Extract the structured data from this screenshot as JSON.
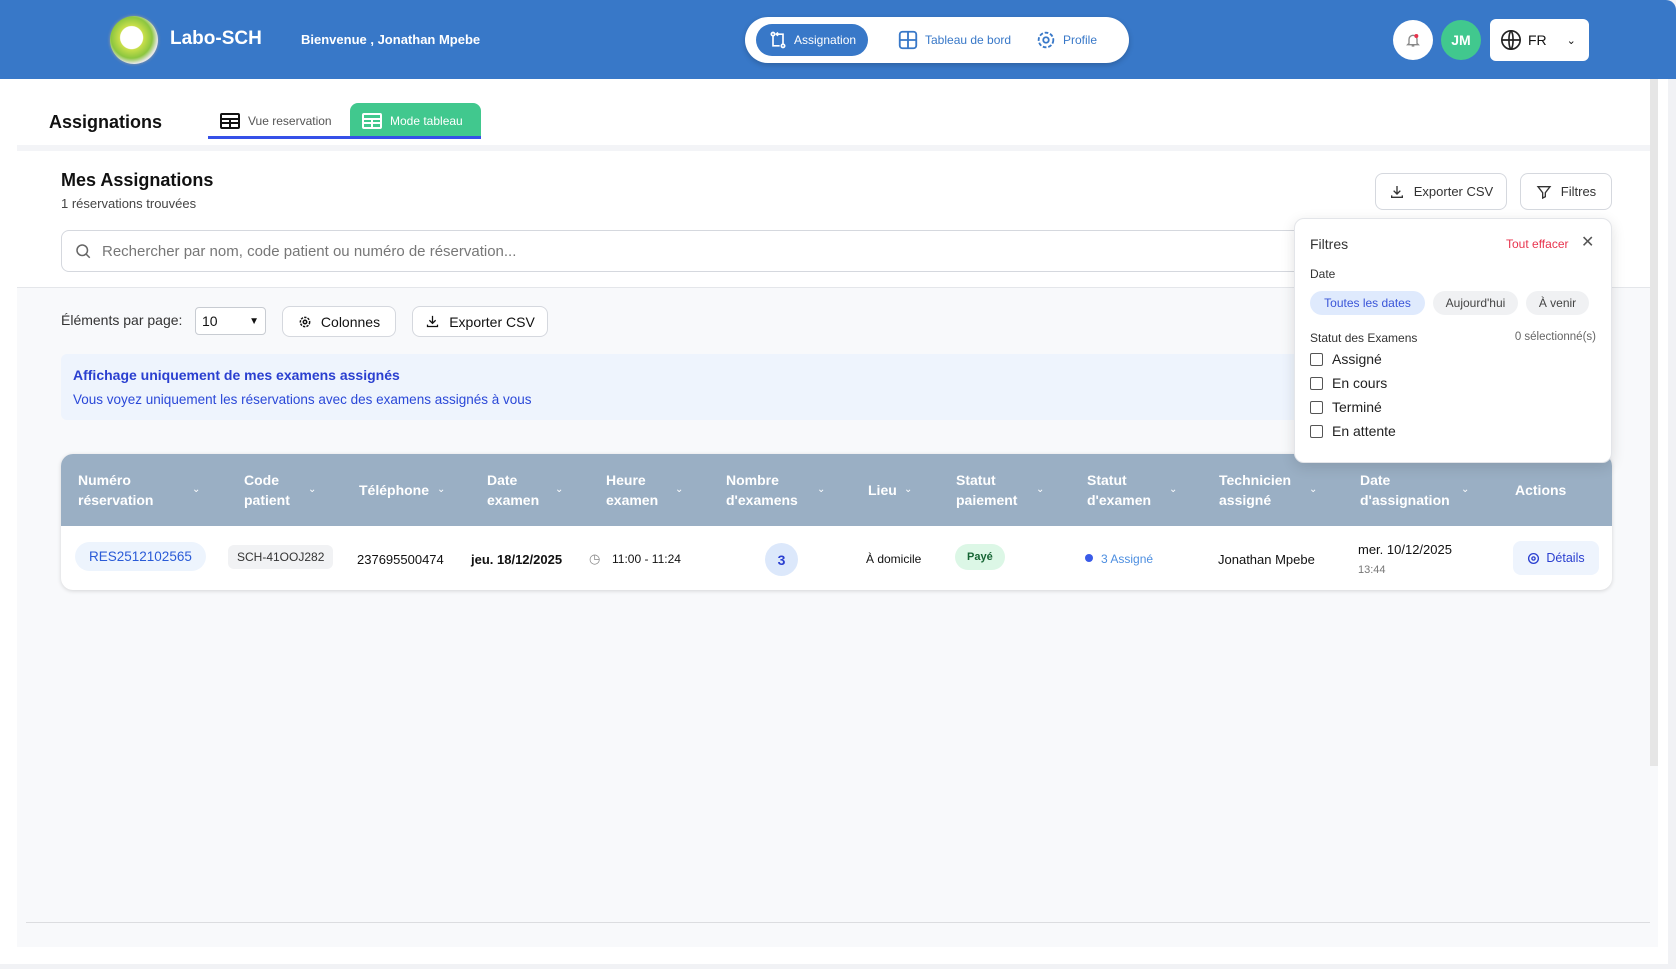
{
  "header": {
    "brand": "Labo-SCH",
    "welcome": "Bienvenue , Jonathan Mpebe",
    "nav": [
      {
        "label": "Assignation",
        "active": true
      },
      {
        "label": "Tableau de bord"
      },
      {
        "label": "Profile"
      }
    ],
    "avatar": "JM",
    "language": "FR"
  },
  "page": {
    "title": "Assignations",
    "tabs": [
      {
        "label": "Vue reservation"
      },
      {
        "label": "Mode tableau",
        "active": true
      }
    ]
  },
  "section": {
    "title": "Mes Assignations",
    "count": "1 réservations trouvées",
    "export_label": "Exporter CSV",
    "filters_label": "Filtres",
    "search_placeholder": "Rechercher par nom, code patient ou numéro de réservation..."
  },
  "toolbar": {
    "per_page_label": "Éléments par page:",
    "per_page_value": "10",
    "columns_label": "Colonnes",
    "export_label": "Exporter CSV"
  },
  "info": {
    "title": "Affichage uniquement de mes examens assignés",
    "text": "Vous voyez uniquement les réservations avec des examens assignés à vous"
  },
  "table": {
    "columns": [
      "Numéro réservation",
      "Code patient",
      "Téléphone",
      "Date examen",
      "Heure examen",
      "Nombre d'examens",
      "Lieu",
      "Statut paiement",
      "Statut d'examen",
      "Technicien assigné",
      "Date d'assignation",
      "Actions"
    ],
    "rows": [
      {
        "reservation": "RES2512102565",
        "patient_code": "SCH-41OOJ282",
        "phone": "237695500474",
        "exam_date": "jeu. 18/12/2025",
        "exam_time": "11:00 - 11:24",
        "exam_count": "3",
        "place": "À domicile",
        "payment": "Payé",
        "exam_status": "3 Assigné",
        "technician": "Jonathan Mpebe",
        "assign_date": "mer. 10/12/2025",
        "assign_time": "13:44",
        "action": "Détails"
      }
    ]
  },
  "filters": {
    "title": "Filtres",
    "clear": "Tout effacer",
    "date_label": "Date",
    "date_options": [
      "Toutes les dates",
      "Aujourd'hui",
      "À venir"
    ],
    "date_selected": "Toutes les dates",
    "status_label": "Statut des Examens",
    "selected_count": "0 sélectionné(s)",
    "statuses": [
      "Assigné",
      "En cours",
      "Terminé",
      "En attente"
    ]
  },
  "colors": {
    "header": "#3878c8",
    "accent_green": "#41c88e",
    "table_header": "#9aafc4",
    "link": "#2a5bd7",
    "danger": "#e8344e"
  }
}
